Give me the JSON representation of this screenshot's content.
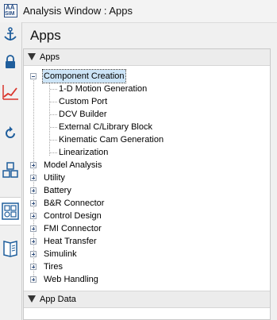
{
  "window": {
    "title": "Analysis Window : Apps",
    "icon_text_top": "AA",
    "icon_text_bottom": "SIM"
  },
  "toolstrip": {
    "tools": [
      {
        "name": "anchor-icon"
      },
      {
        "name": "lock-icon"
      },
      {
        "name": "line-chart-icon"
      },
      {
        "name": "refresh-icon"
      },
      {
        "name": "cubes-icon"
      },
      {
        "name": "apps-grid-icon"
      },
      {
        "name": "book-icon"
      }
    ]
  },
  "panel": {
    "title": "Apps"
  },
  "apps_section": {
    "label": "Apps"
  },
  "tree": {
    "component_creation": {
      "label": "Component Creation",
      "children": [
        "1-D Motion Generation",
        "Custom Port",
        "DCV Builder",
        "External C/Library Block",
        "Kinematic Cam Generation",
        "Linearization"
      ]
    },
    "collapsed": [
      "Model Analysis",
      "Utility",
      "Battery",
      "B&R Connector",
      "Control Design",
      "FMI Connector",
      "Heat Transfer",
      "Simulink",
      "Tires",
      "Web Handling"
    ]
  },
  "app_data_section": {
    "label": "App Data"
  },
  "colors": {
    "accent": "#2a4f86",
    "selection": "#cce4f7",
    "chart_red": "#d9342b"
  }
}
